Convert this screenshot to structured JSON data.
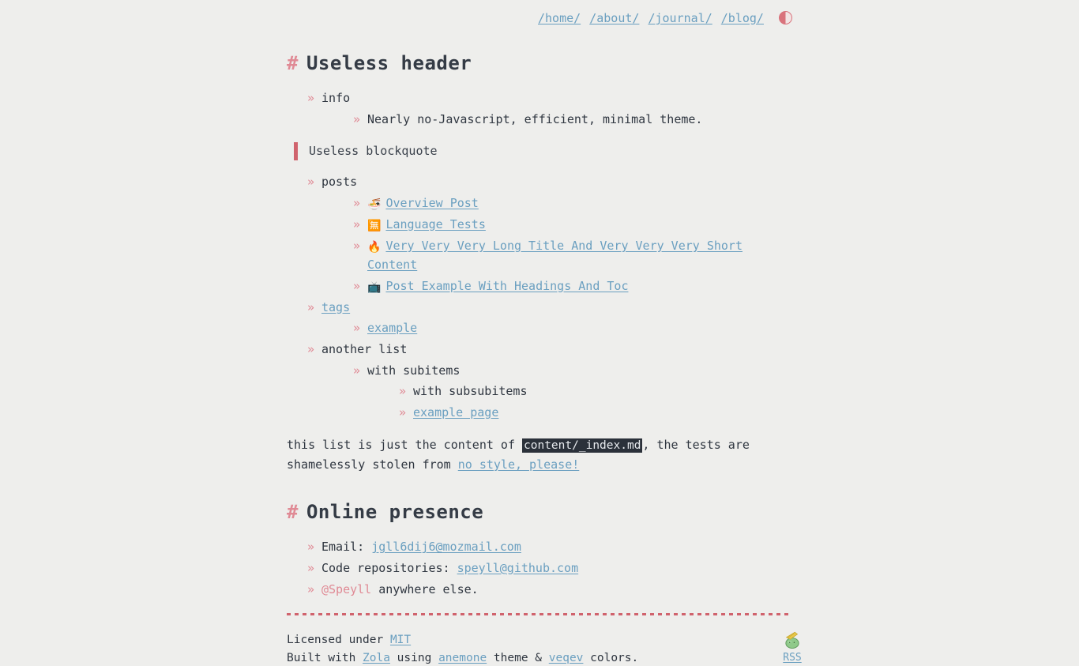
{
  "nav": {
    "links": [
      {
        "label": "/home/"
      },
      {
        "label": "/about/"
      },
      {
        "label": "/journal/"
      },
      {
        "label": "/blog/"
      }
    ],
    "theme_toggle_icon": "half-circle-icon"
  },
  "sections": {
    "heading1": {
      "hash": "#",
      "title": "Useless header"
    },
    "heading2": {
      "hash": "#",
      "title": "Online presence"
    }
  },
  "info": {
    "label": "info",
    "detail": "Nearly no-Javascript, efficient, minimal theme."
  },
  "blockquote": {
    "text": "Useless blockquote"
  },
  "posts": {
    "label": "posts",
    "items": [
      {
        "emoji": "🍜",
        "emoji_name": "steaming-bowl-icon",
        "title": "Overview Post"
      },
      {
        "emoji": "🈚",
        "emoji_name": "japanese-free-of-charge-icon",
        "title": "Language Tests"
      },
      {
        "emoji": "🔥",
        "emoji_name": "fire-icon",
        "title": "Very Very Very Long Title And Very Very Very Short Content"
      },
      {
        "emoji": "📺",
        "emoji_name": "television-icon",
        "title": "Post Example With Headings And Toc"
      }
    ]
  },
  "tags": {
    "label": "tags",
    "items": [
      {
        "label": "example"
      }
    ]
  },
  "another_list": {
    "label": "another list",
    "sub": {
      "label": "with subitems",
      "items": [
        {
          "label": "with subsubitems",
          "link": false
        },
        {
          "label": "example page",
          "link": true
        }
      ]
    }
  },
  "paragraph": {
    "before_code": "this list is just the content of ",
    "code": "content/_index.md",
    "after_code": ", the tests are shamelessly stolen from ",
    "link": "no style, please!"
  },
  "online_presence": {
    "items": [
      {
        "prefix": "Email: ",
        "link": "jgll6dij6@mozmail.com",
        "suffix": ""
      },
      {
        "prefix": "Code repositories: ",
        "link": "speyll@github.com",
        "suffix": ""
      },
      {
        "prefix": "",
        "accent": "@Speyll",
        "suffix": " anywhere else."
      }
    ]
  },
  "footer": {
    "license_prefix": "Licensed under ",
    "license_link": "MIT",
    "built_prefix": "Built with ",
    "built_link": "Zola",
    "using": " using ",
    "theme_link": "anemone",
    "theme_suffix": " theme & ",
    "colors_link": "veqev",
    "colors_suffix": " colors.",
    "rss_label": "RSS",
    "rss_icon_name": "rss-mascot-icon"
  },
  "colors": {
    "background": "#eeeeec",
    "text": "#2f3640",
    "link": "#6a9fc0",
    "accent": "#e08a95",
    "quote_bar": "#d0636d",
    "code_bg": "#2b313a",
    "code_fg": "#e7eaee"
  }
}
